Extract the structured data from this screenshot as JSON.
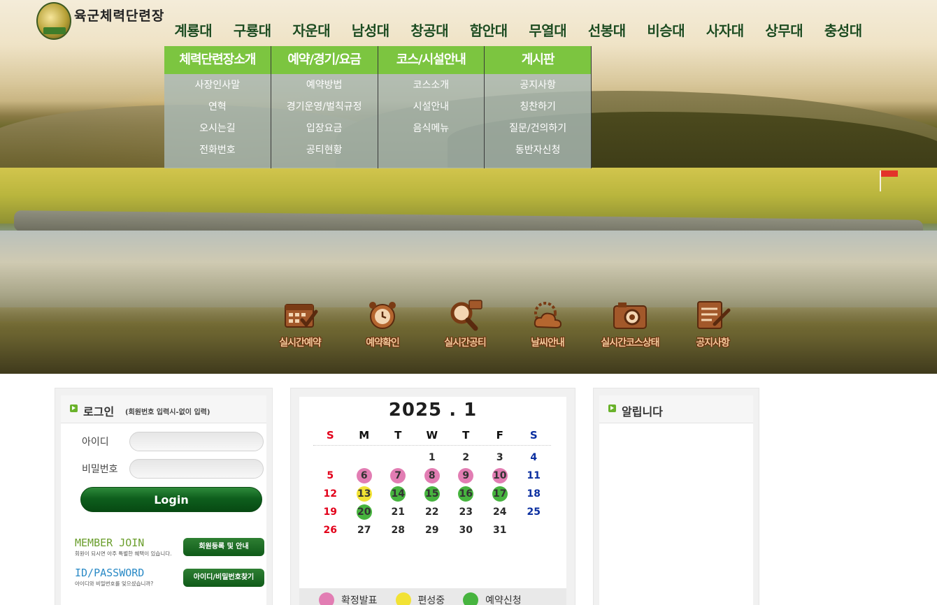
{
  "logo": {
    "text": "육군체력단련장"
  },
  "topnav": [
    "계룡대",
    "구룡대",
    "자운대",
    "남성대",
    "창공대",
    "함안대",
    "무열대",
    "선봉대",
    "비승대",
    "사자대",
    "상무대",
    "충성대"
  ],
  "mega_menu": [
    {
      "head": "체력단련장소개",
      "items": [
        "사장인사말",
        "연혁",
        "오시는길",
        "전화번호"
      ]
    },
    {
      "head": "예약/경기/요금",
      "items": [
        "예약방법",
        "경기운영/벌칙규정",
        "입장요금",
        "공티현황"
      ]
    },
    {
      "head": "코스/시설안내",
      "items": [
        "코스소개",
        "시설안내",
        "음식메뉴"
      ]
    },
    {
      "head": "게시판",
      "items": [
        "공지사항",
        "칭찬하기",
        "질문/건의하기",
        "동반자신청"
      ]
    }
  ],
  "quick_links": [
    {
      "label": "실시간예약",
      "icon": "calendar-check-icon"
    },
    {
      "label": "예약확인",
      "icon": "alarm-clock-icon"
    },
    {
      "label": "실시간공티",
      "icon": "magnifier-icon"
    },
    {
      "label": "날씨안내",
      "icon": "weather-cloud-icon"
    },
    {
      "label": "실시간코스상태",
      "icon": "camera-icon"
    },
    {
      "label": "공지사항",
      "icon": "notepad-pen-icon"
    }
  ],
  "login": {
    "title": "로그인",
    "subtitle": "(회원번호 입력시-없이 입력)",
    "id_label": "아이디",
    "pw_label": "비밀번호",
    "login_button": "Login",
    "member_join_title": "MEMBER JOIN",
    "member_join_desc": "회원이 되시면 아주 특별한 혜택이 있습니다.",
    "member_join_button": "회원등록 및 안내",
    "idpw_title": "ID/PASSWORD",
    "idpw_desc": "아이디와 비밀번호를 잊으셨습니까?",
    "idpw_button": "아이디/비밀번호찾기"
  },
  "calendar": {
    "title": "2025 . 1",
    "weekdays": [
      "S",
      "M",
      "T",
      "W",
      "T",
      "F",
      "S"
    ],
    "weeks": [
      [
        "",
        "",
        "",
        "1",
        "2",
        "3",
        "4"
      ],
      [
        "5",
        "6",
        "7",
        "8",
        "9",
        "10",
        "11"
      ],
      [
        "12",
        "13",
        "14",
        "15",
        "16",
        "17",
        "18"
      ],
      [
        "19",
        "20",
        "21",
        "22",
        "23",
        "24",
        "25"
      ],
      [
        "26",
        "27",
        "28",
        "29",
        "30",
        "31",
        ""
      ]
    ],
    "status": {
      "6": "confirmed",
      "7": "confirmed",
      "8": "confirmed",
      "9": "confirmed",
      "10": "confirmed",
      "13": "scheduling",
      "14": "reservation",
      "15": "reservation",
      "16": "reservation",
      "17": "reservation",
      "20": "reservation"
    },
    "legend": [
      {
        "key": "confirmed",
        "label": "확정발표"
      },
      {
        "key": "scheduling",
        "label": "편성중"
      },
      {
        "key": "reservation",
        "label": "예약신청"
      }
    ],
    "colors": {
      "confirmed": "#e27db3",
      "scheduling": "#f2e234",
      "reservation": "#47b43f",
      "sunday": "#e2001a",
      "saturday": "#0b2fa0",
      "weekday": "#2a2a2a"
    }
  },
  "notice": {
    "title": "알립니다"
  }
}
